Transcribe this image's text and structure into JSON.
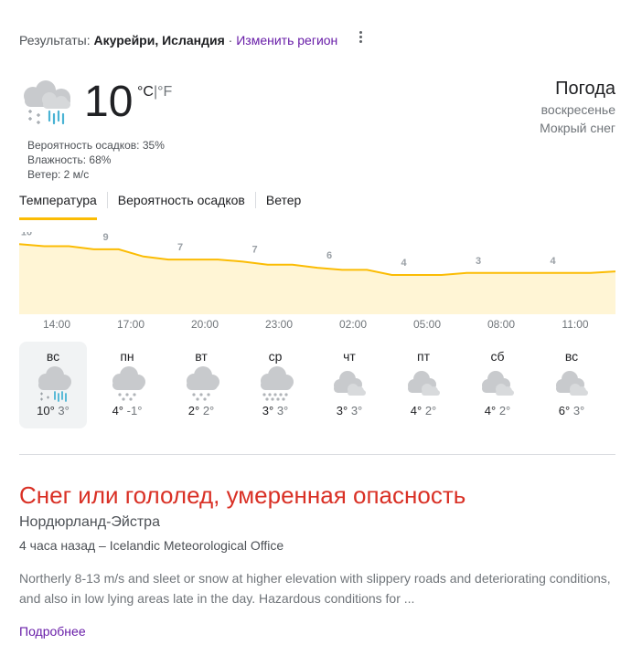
{
  "header": {
    "results_prefix": "Результаты:",
    "location": "Акурейри, Исландия",
    "separator": "·",
    "change_region": "Изменить регион"
  },
  "current": {
    "icon": "sleet-icon",
    "temperature": "10",
    "unit_c": "°C",
    "unit_divider": "|",
    "unit_f": "°F",
    "precipitation": "Вероятность осадков: 35%",
    "humidity": "Влажность: 68%",
    "wind": "Ветер: 2 м/с"
  },
  "title": {
    "heading": "Погода",
    "day": "воскресенье",
    "condition": "Мокрый снег"
  },
  "tabs": [
    {
      "label": "Температура",
      "active": true
    },
    {
      "label": "Вероятность осадков",
      "active": false
    },
    {
      "label": "Ветер",
      "active": false
    }
  ],
  "chart_data": {
    "type": "area",
    "x": [
      "14:00",
      "15:00",
      "16:00",
      "17:00",
      "18:00",
      "19:00",
      "20:00",
      "21:00",
      "22:00",
      "23:00",
      "00:00",
      "01:00",
      "02:00",
      "03:00",
      "04:00",
      "05:00",
      "06:00",
      "07:00",
      "08:00",
      "09:00",
      "10:00",
      "11:00",
      "12:00",
      "13:00",
      "14:00"
    ],
    "values": [
      10,
      9.6,
      9.6,
      9,
      9,
      7.6,
      7,
      7,
      7,
      6.6,
      6,
      6,
      5.4,
      5,
      5,
      4,
      4,
      4,
      4.4,
      4.4,
      4.4,
      4.4,
      4.4,
      4.4,
      4.7
    ],
    "labels": [
      {
        "index": 0,
        "text": "10"
      },
      {
        "index": 3,
        "text": "9"
      },
      {
        "index": 6,
        "text": "7"
      },
      {
        "index": 9,
        "text": "7"
      },
      {
        "index": 12,
        "text": "6"
      },
      {
        "index": 15,
        "text": "4"
      },
      {
        "index": 18,
        "text": "3"
      },
      {
        "index": 21,
        "text": "4"
      }
    ],
    "tick_labels": [
      "14:00",
      "17:00",
      "20:00",
      "23:00",
      "02:00",
      "05:00",
      "08:00",
      "11:00"
    ],
    "ylim": [
      -4,
      12
    ],
    "line_color": "#fbbc04",
    "fill_color": "#fff5d5"
  },
  "days": [
    {
      "name": "вс",
      "hi": "10°",
      "lo": "3°",
      "icon": "sleet-icon",
      "selected": true
    },
    {
      "name": "пн",
      "hi": "4°",
      "lo": "-1°",
      "icon": "snow-icon",
      "selected": false
    },
    {
      "name": "вт",
      "hi": "2°",
      "lo": "2°",
      "icon": "snow-icon",
      "selected": false
    },
    {
      "name": "ср",
      "hi": "3°",
      "lo": "3°",
      "icon": "heavy-snow-icon",
      "selected": false
    },
    {
      "name": "чт",
      "hi": "3°",
      "lo": "3°",
      "icon": "cloudy-icon",
      "selected": false
    },
    {
      "name": "пт",
      "hi": "4°",
      "lo": "2°",
      "icon": "cloudy-icon",
      "selected": false
    },
    {
      "name": "сб",
      "hi": "4°",
      "lo": "2°",
      "icon": "cloudy-icon",
      "selected": false
    },
    {
      "name": "вс",
      "hi": "6°",
      "lo": "3°",
      "icon": "cloudy-icon",
      "selected": false
    }
  ],
  "alert": {
    "title": "Снег или гололед, умеренная опасность",
    "region": "Нордюрланд-Эйстра",
    "meta": "4 часа назад – Icelandic Meteorological Office",
    "text": "Northerly 8-13 m/s and sleet or snow at higher elevation with slippery roads and deteriorating conditions, and also in low lying areas late in the day. Hazardous conditions for ...",
    "more": "Подробнее",
    "color": "#d93025"
  }
}
